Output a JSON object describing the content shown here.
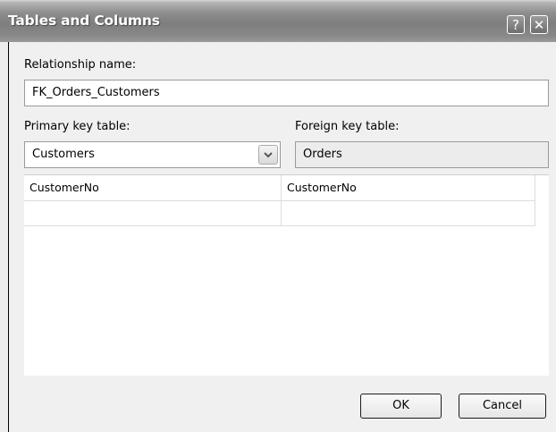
{
  "dialog": {
    "title": "Tables and Columns",
    "help_glyph": "?",
    "close_glyph": "✕"
  },
  "relationship": {
    "label": "Relationship name:",
    "value": "FK_Orders_Customers"
  },
  "primary": {
    "label": "Primary key table:",
    "value": "Customers"
  },
  "foreign": {
    "label": "Foreign key table:",
    "value": "Orders"
  },
  "columns_grid": {
    "rows": [
      {
        "primary": "CustomerNo",
        "foreign": "CustomerNo"
      },
      {
        "primary": "",
        "foreign": ""
      }
    ]
  },
  "buttons": {
    "ok": "OK",
    "cancel": "Cancel"
  }
}
